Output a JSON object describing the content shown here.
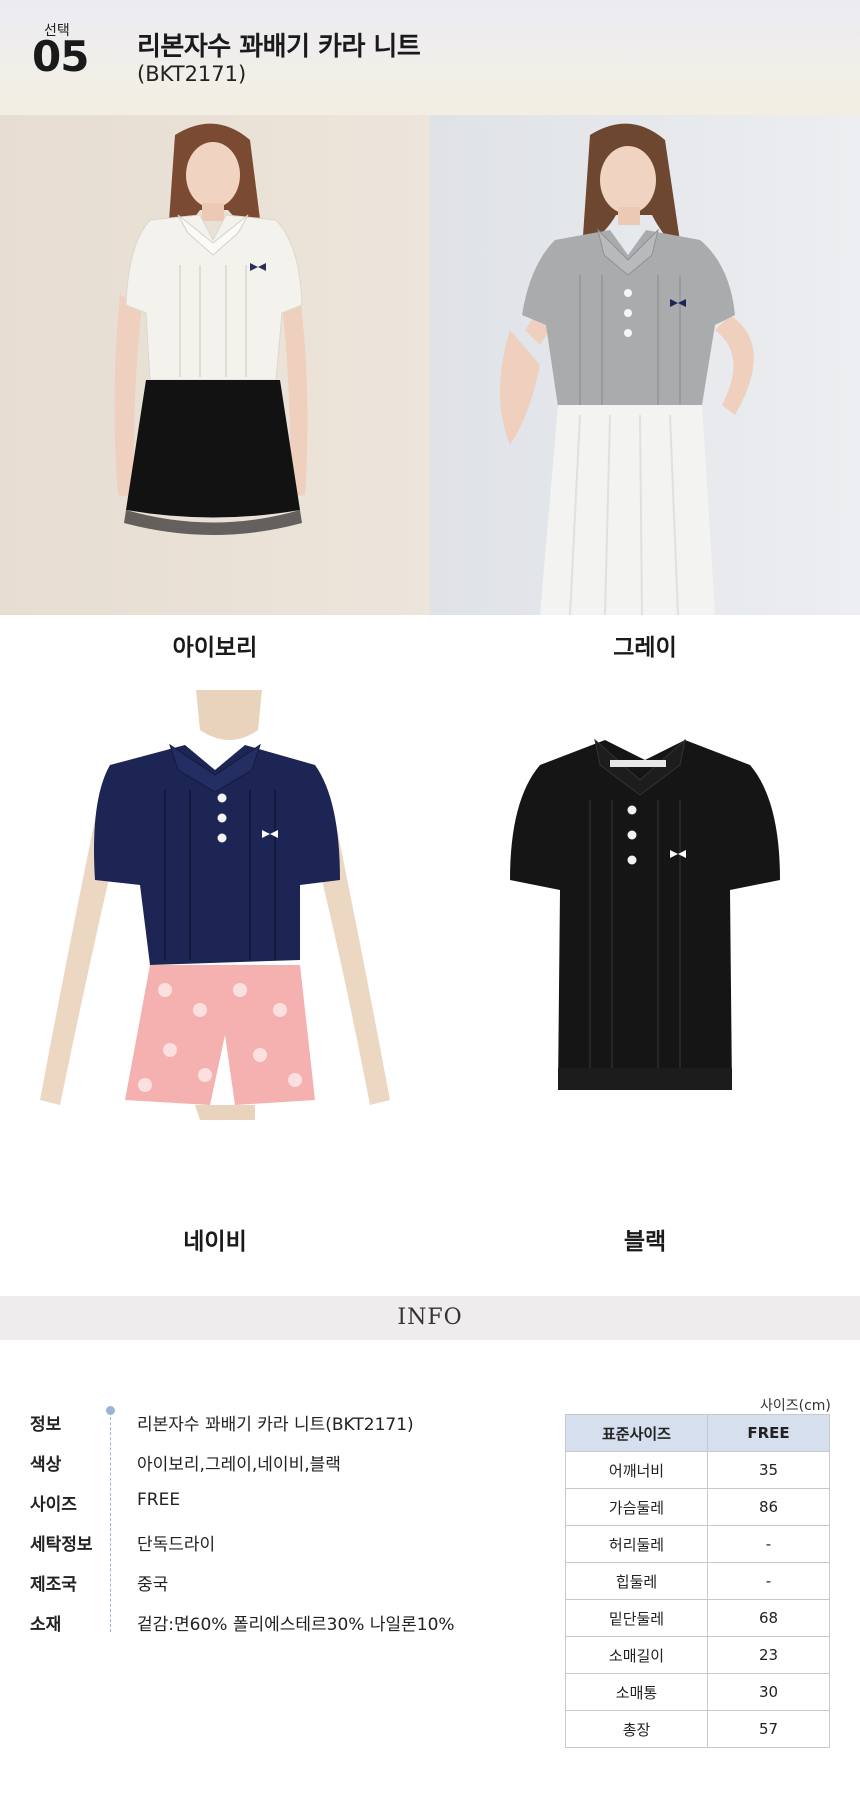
{
  "header": {
    "select_label": "선택",
    "select_number": "05",
    "product_title": "리본자수 꽈배기 카라 니트",
    "product_code": "(BKT2171)"
  },
  "photos": [
    {
      "color": "아이보리",
      "knit_color": "#f4f2ec",
      "bg": "#e9e0d6"
    },
    {
      "color": "그레이",
      "knit_color": "#a9abad",
      "bg": "#e4e6ea"
    },
    {
      "color": "네이비",
      "knit_color": "#1d2554",
      "bg": "#ffffff"
    },
    {
      "color": "블랙",
      "knit_color": "#151515",
      "bg": "#ffffff"
    }
  ],
  "info_band": "INFO",
  "info": [
    {
      "key": "정보",
      "value": "리본자수 꽈배기 카라 니트(BKT2171)"
    },
    {
      "key": "색상",
      "value": "아이보리,그레이,네이비,블랙"
    },
    {
      "key": "사이즈",
      "value": "FREE"
    },
    {
      "key": "세탁정보",
      "value": "단독드라이"
    },
    {
      "key": "제조국",
      "value": "중국"
    },
    {
      "key": "소재",
      "value": "겉감:면60% 폴리에스테르30% 나일론10%"
    }
  ],
  "size_table": {
    "unit": "사이즈(cm)",
    "header": [
      "표준사이즈",
      "FREE"
    ],
    "rows": [
      [
        "어깨너비",
        "35"
      ],
      [
        "가슴둘레",
        "86"
      ],
      [
        "허리둘레",
        "-"
      ],
      [
        "힙둘레",
        "-"
      ],
      [
        "밑단둘레",
        "68"
      ],
      [
        "소매길이",
        "23"
      ],
      [
        "소매통",
        "30"
      ],
      [
        "총장",
        "57"
      ]
    ]
  }
}
